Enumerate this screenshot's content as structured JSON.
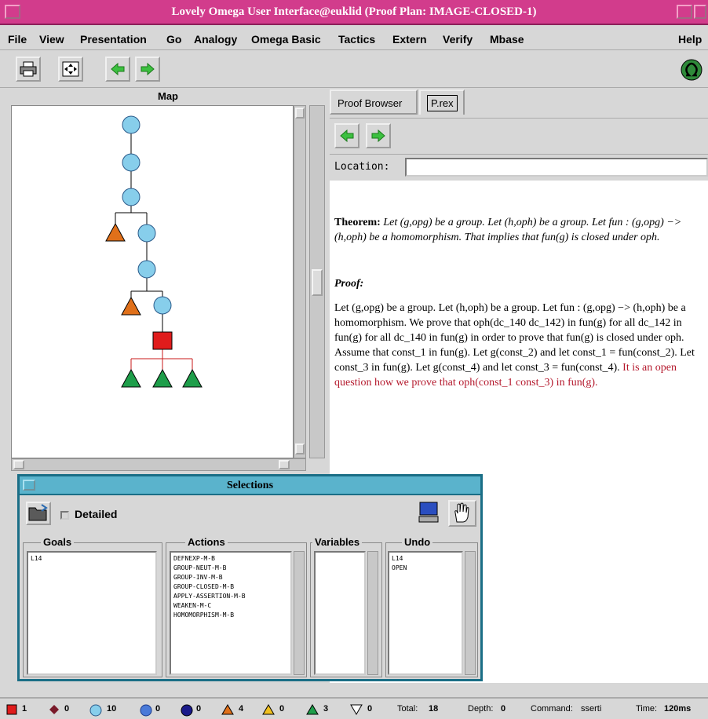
{
  "window": {
    "title": "Lovely Omega User Interface@euklid (Proof Plan: IMAGE-CLOSED-1)"
  },
  "menu": [
    "File",
    "View",
    "Presentation",
    "Go",
    "Analogy",
    "Omega Basic",
    "Tactics",
    "Extern",
    "Verify",
    "Mbase",
    "Help"
  ],
  "toolbar": {
    "icons": [
      "printer-icon",
      "fit-view-icon",
      "back-arrow-icon",
      "forward-arrow-icon",
      "omega-logo-icon"
    ]
  },
  "map": {
    "header": "Map"
  },
  "right": {
    "tabs": [
      "Proof Browser",
      "P.rex"
    ],
    "location_label": "Location:",
    "location_value": ""
  },
  "document": {
    "theorem_label": "Theorem:",
    "theorem_text": "Let (g,opg) be a group. Let (h,oph) be a group. Let fun : (g,opg) −> (h,oph) be a homomorphism. That implies that fun(g) is closed under oph.",
    "proof_label": "Proof:",
    "proof_text": "Let (g,opg) be a group. Let (h,oph) be a group. Let fun : (g,opg) −> (h,oph) be a homomorphism. We prove that oph(dc_140 dc_142) in fun(g) for all dc_142 in fun(g) for all dc_140 in fun(g) in order to prove that fun(g) is closed under oph. Assume that const_1 in fun(g). Let g(const_2) and let const_1 = fun(const_2). Let const_3 in fun(g). Let g(const_4) and let const_3 = fun(const_4).",
    "proof_open": "It is an open question how we prove that oph(const_1 const_3) in fun(g)."
  },
  "selections": {
    "title": "Selections",
    "detailed_label": "Detailed",
    "goals_label": "Goals",
    "actions_label": "Actions",
    "variables_label": "Variables",
    "undo_label": "Undo",
    "goals": [
      "L14"
    ],
    "actions": [
      "DEFNEXP-M-B",
      "GROUP-NEUT-M-B",
      "GROUP-INV-M-B",
      "GROUP-CLOSED-M-B",
      "APPLY-ASSERTION-M-B",
      "WEAKEN-M-C",
      "HOMOMORPHISM-M-B"
    ],
    "variables": [],
    "undo": [
      "L14",
      "OPEN"
    ]
  },
  "status": {
    "counts": [
      "1",
      "0",
      "10",
      "0",
      "0",
      "4",
      "0",
      "3",
      "0"
    ],
    "total_label": "Total:",
    "total": "18",
    "depth_label": "Depth:",
    "depth": "0",
    "command_label": "Command:",
    "command": "sserti",
    "time_label": "Time:",
    "time": "120ms"
  },
  "colors": {
    "title_bar": "#d23c8c",
    "node_circle": "#87ceeb",
    "node_orange": "#e0701a",
    "node_green": "#1e9e4a",
    "node_red": "#e01c1c",
    "open_text": "#b4182c",
    "selections_title": "#5ab3cc"
  }
}
